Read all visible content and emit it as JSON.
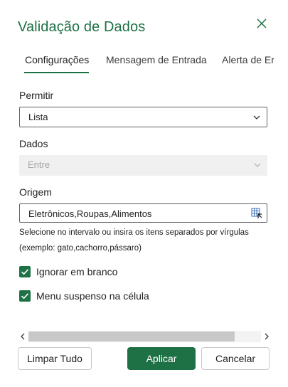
{
  "dialog": {
    "title": "Validação de Dados",
    "close_icon": "close-icon",
    "accent_color": "#1e7145"
  },
  "tabs": [
    {
      "label": "Configurações",
      "active": true
    },
    {
      "label": "Mensagem de Entrada",
      "active": false
    },
    {
      "label": "Alerta de Erro",
      "active": false
    }
  ],
  "settings": {
    "allow_label": "Permitir",
    "allow_value": "Lista",
    "data_label": "Dados",
    "data_value": "Entre",
    "source_label": "Origem",
    "source_value": "Eletrônicos,Roupas,Alimentos",
    "hint_line1": "Selecione no intervalo ou insira os itens separados por vírgulas",
    "hint_line2": "(exemplo: gato,cachorro,pássaro)",
    "ignore_blank_label": "Ignorar em branco",
    "ignore_blank_checked": true,
    "dropdown_label": "Menu suspenso na célula",
    "dropdown_checked": true
  },
  "buttons": {
    "clear": "Limpar Tudo",
    "apply": "Aplicar",
    "cancel": "Cancelar"
  }
}
